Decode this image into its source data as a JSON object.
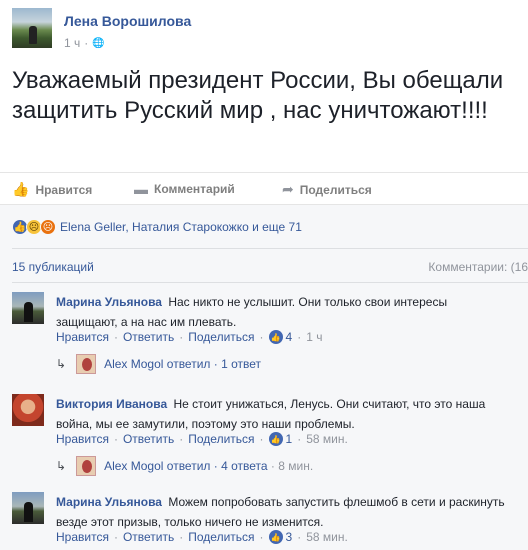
{
  "post": {
    "author": "Лена Ворошилова",
    "time": "1 ч",
    "privacy_icon": "globe-icon",
    "text": "Уважаемый президент России, Вы обещали защитить Русский мир , нас уничтожают!!!!"
  },
  "actions": {
    "like": "Нравится",
    "comment": "Комментарий",
    "share": "Поделиться"
  },
  "reactions": {
    "icons": [
      "like",
      "sad",
      "angry"
    ],
    "names": "Elena Geller, Наталия Старокожко и еще 71"
  },
  "counts": {
    "publications": "15 публикаций",
    "comments": "Комментарии: (16"
  },
  "comments": [
    {
      "author": "Марина Ульянова",
      "text": "Нас никто не услышит. Они только свои интересы защищают, а на нас им плевать.",
      "like": "Нравится",
      "reply": "Ответить",
      "share": "Поделиться",
      "likes": "4",
      "time": "1 ч",
      "reply_author": "Alex Mogol",
      "reply_text": "ответил · 1 ответ",
      "reply_time": ""
    },
    {
      "author": "Виктория Иванова",
      "text": "Не стоит унижаться, Ленусь. Они считают, что это наша война, мы ее замутили, поэтому это наши проблемы.",
      "like": "Нравится",
      "reply": "Ответить",
      "share": "Поделиться",
      "likes": "1",
      "time": "58 мин.",
      "reply_author": "Alex Mogol",
      "reply_text": "ответил · 4 ответа",
      "reply_time": "8 мин."
    },
    {
      "author": "Марина Ульянова",
      "text": "Можем попробовать запустить флешмоб в сети и раскинуть везде этот призыв, только ничего не изменится.",
      "like": "Нравится",
      "reply": "Ответить",
      "share": "Поделиться",
      "likes": "3",
      "time": "58 мин."
    }
  ],
  "colors": {
    "link": "#365899",
    "meta": "#90949c",
    "like_blue": "#4267b2"
  }
}
